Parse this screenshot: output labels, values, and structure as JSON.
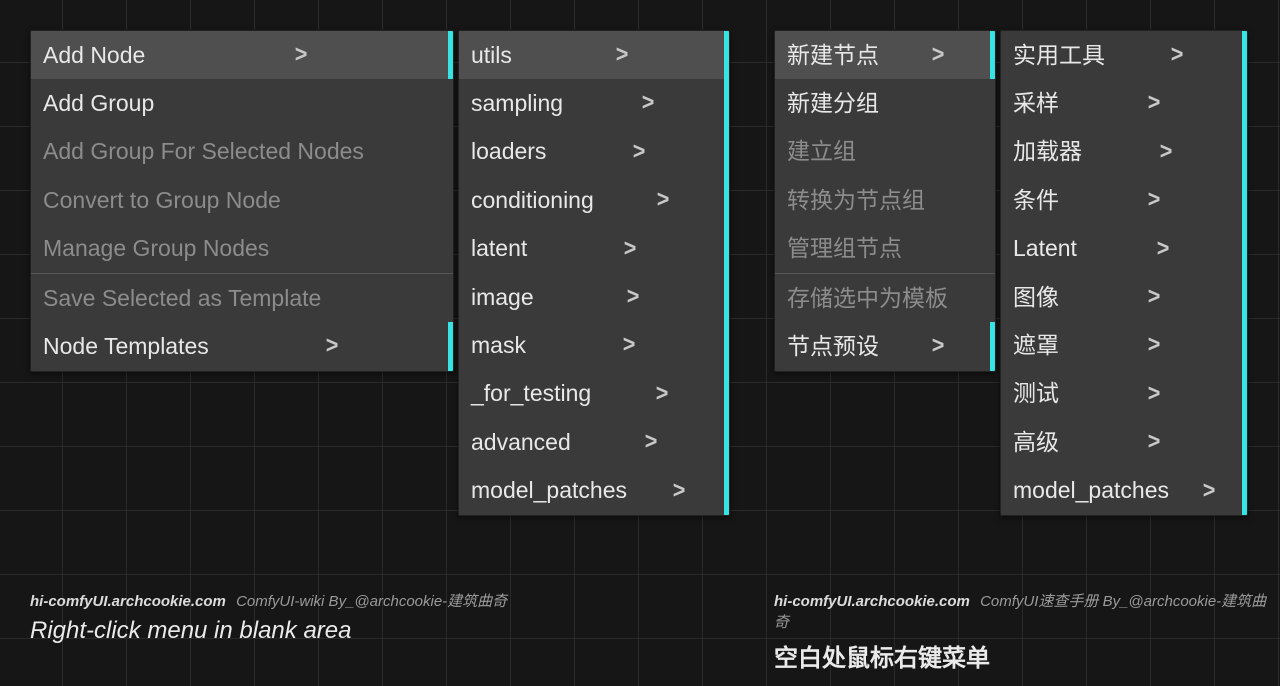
{
  "colors": {
    "accent": "#38e3e3"
  },
  "left": {
    "context": {
      "items": [
        {
          "label": "Add Node",
          "has_submenu": true,
          "highlight": true,
          "stripe": true
        },
        {
          "label": "Add Group",
          "has_submenu": false
        },
        {
          "label": "Add Group For Selected Nodes",
          "has_submenu": false,
          "disabled": true
        },
        {
          "label": "Convert to Group Node",
          "has_submenu": false,
          "disabled": true
        },
        {
          "label": "Manage Group Nodes",
          "has_submenu": false,
          "disabled": true
        },
        {
          "divider": true
        },
        {
          "label": "Save Selected as Template",
          "has_submenu": false,
          "disabled": true
        },
        {
          "label": "Node Templates",
          "has_submenu": true,
          "stripe": true
        }
      ]
    },
    "submenu": {
      "items": [
        {
          "label": "utils",
          "highlight": true
        },
        {
          "label": "sampling"
        },
        {
          "label": "loaders"
        },
        {
          "label": "conditioning"
        },
        {
          "label": "latent"
        },
        {
          "label": "image"
        },
        {
          "label": "mask"
        },
        {
          "label": "_for_testing"
        },
        {
          "label": "advanced"
        },
        {
          "label": "model_patches"
        }
      ]
    },
    "footer_url": "hi-comfyUI.archcookie.com",
    "footer_credit": "ComfyUI-wiki  By_@archcookie-建筑曲奇",
    "caption": "Right-click menu in blank area"
  },
  "right": {
    "context": {
      "items": [
        {
          "label": "新建节点",
          "has_submenu": true,
          "highlight": true,
          "stripe": true
        },
        {
          "label": "新建分组",
          "has_submenu": false
        },
        {
          "label": "建立组",
          "has_submenu": false,
          "disabled": true
        },
        {
          "label": "转换为节点组",
          "has_submenu": false,
          "disabled": true
        },
        {
          "label": "管理组节点",
          "has_submenu": false,
          "disabled": true
        },
        {
          "divider": true
        },
        {
          "label": "存储选中为模板",
          "has_submenu": false,
          "disabled": true
        },
        {
          "label": "节点预设",
          "has_submenu": true,
          "stripe": true
        }
      ]
    },
    "submenu": {
      "items": [
        {
          "label": "实用工具"
        },
        {
          "label": "采样"
        },
        {
          "label": "加载器"
        },
        {
          "label": "条件"
        },
        {
          "label": "Latent"
        },
        {
          "label": "图像"
        },
        {
          "label": "遮罩"
        },
        {
          "label": "测试"
        },
        {
          "label": "高级"
        },
        {
          "label": "model_patches"
        }
      ]
    },
    "footer_url": "hi-comfyUI.archcookie.com",
    "footer_credit": "ComfyUI速查手册  By_@archcookie-建筑曲奇",
    "caption": "空白处鼠标右键菜单"
  }
}
